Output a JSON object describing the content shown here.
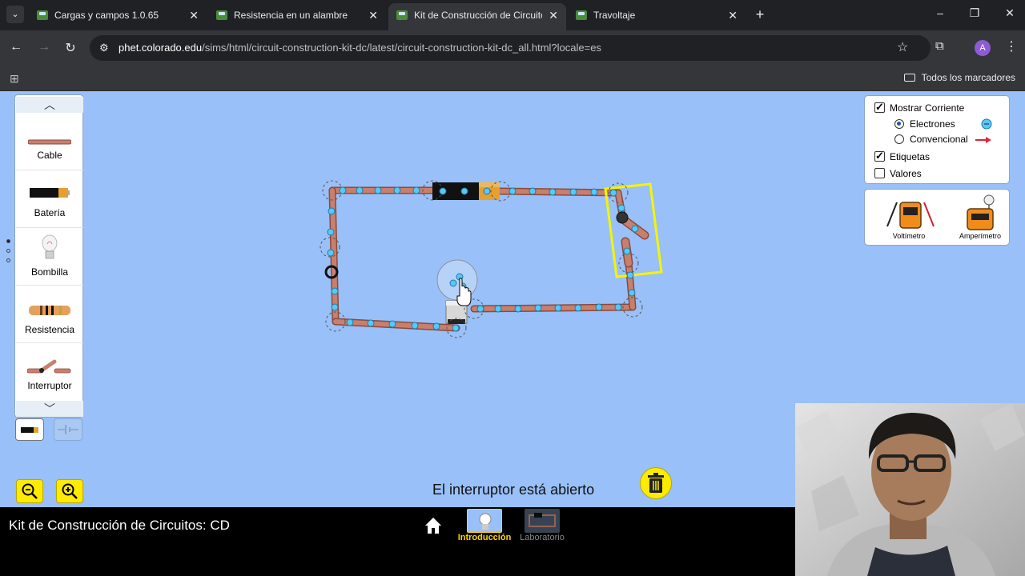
{
  "browser": {
    "tabs": [
      {
        "title": "Cargas y campos 1.0.65",
        "active": false
      },
      {
        "title": "Resistencia en un alambre",
        "active": false
      },
      {
        "title": "Kit de Construcción de Circuitos",
        "active": true
      },
      {
        "title": "Travoltaje",
        "active": false
      }
    ],
    "url_domain": "phet.colorado.edu",
    "url_path": "/sims/html/circuit-construction-kit-dc/latest/circuit-construction-kit-dc_all.html?locale=es",
    "profile_initial": "A",
    "bookmarks_label": "Todos los marcadores"
  },
  "palette": {
    "items": [
      {
        "label": "Cable",
        "icon": "wire-icon"
      },
      {
        "label": "Batería",
        "icon": "battery-icon"
      },
      {
        "label": "Bombilla",
        "icon": "lightbulb-icon"
      },
      {
        "label": "Resistencia",
        "icon": "resistor-icon"
      },
      {
        "label": "Interruptor",
        "icon": "switch-icon"
      }
    ]
  },
  "controls": {
    "show_current": {
      "label": "Mostrar Corriente",
      "checked": true
    },
    "electrons": {
      "label": "Electrones",
      "selected": true
    },
    "conventional": {
      "label": "Convencional",
      "selected": false
    },
    "labels": {
      "label": "Etiquetas",
      "checked": true
    },
    "values": {
      "label": "Valores",
      "checked": false
    }
  },
  "meters": {
    "voltmeter": "Voltímetro",
    "ammeter": "Amperímetro"
  },
  "status": "El interruptor está abierto",
  "navbar": {
    "sim_title": "Kit de Construcción de Circuitos: CD",
    "screens": [
      {
        "label": "Introducción",
        "active": true
      },
      {
        "label": "Laboratorio",
        "active": false
      }
    ]
  },
  "colors": {
    "sim_background": "#99c0f8",
    "wire": "#c8806e",
    "electron": "#5ac8f0",
    "switch_highlight": "#f5f500",
    "active_screen": "#ffd400"
  }
}
